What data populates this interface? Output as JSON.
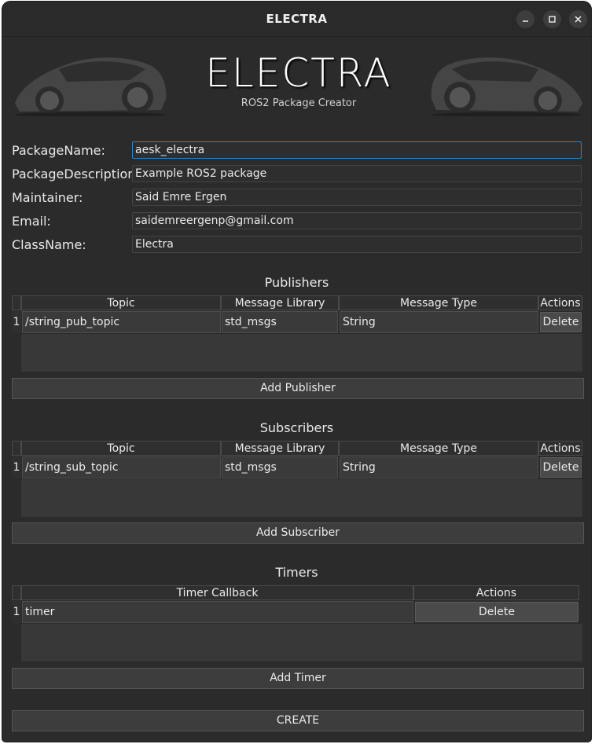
{
  "window": {
    "title": "ELECTRA"
  },
  "banner": {
    "title": "ELECTRA",
    "subtitle": "ROS2 Package Creator"
  },
  "form": {
    "fields": [
      {
        "label": "PackageName:",
        "value": "aesk_electra"
      },
      {
        "label": "PackageDescription:",
        "value": "Example ROS2 package"
      },
      {
        "label": "Maintainer:",
        "value": "Said Emre Ergen"
      },
      {
        "label": "Email:",
        "value": "saidemreergenp@gmail.com"
      },
      {
        "label": "ClassName:",
        "value": "Electra"
      }
    ]
  },
  "publishers": {
    "title": "Publishers",
    "headers": [
      "Topic",
      "Message Library",
      "Message Type",
      "Actions"
    ],
    "rows": [
      {
        "index": "1",
        "topic": "/string_pub_topic",
        "library": "std_msgs",
        "type": "String",
        "action": "Delete"
      }
    ],
    "add_label": "Add Publisher"
  },
  "subscribers": {
    "title": "Subscribers",
    "headers": [
      "Topic",
      "Message Library",
      "Message Type",
      "Actions"
    ],
    "rows": [
      {
        "index": "1",
        "topic": "/string_sub_topic",
        "library": "std_msgs",
        "type": "String",
        "action": "Delete"
      }
    ],
    "add_label": "Add Subscriber"
  },
  "timers": {
    "title": "Timers",
    "headers": [
      "Timer Callback",
      "Actions"
    ],
    "rows": [
      {
        "index": "1",
        "callback": "timer",
        "action": "Delete"
      }
    ],
    "add_label": "Add Timer"
  },
  "create_label": "CREATE",
  "colors": {
    "background": "#2b2b2b",
    "focus_border": "#2d86c9"
  }
}
